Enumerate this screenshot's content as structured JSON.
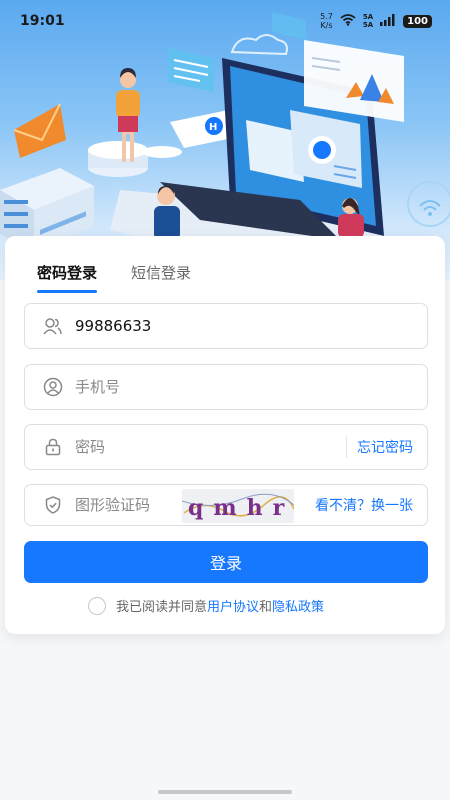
{
  "status_bar": {
    "time": "19:01",
    "net_speed_value": "5.7",
    "net_speed_unit": "K/s",
    "signal_1": "5A",
    "signal_2": "5A",
    "battery": "100"
  },
  "login": {
    "tabs": [
      {
        "label": "密码登录",
        "active": true
      },
      {
        "label": "短信登录",
        "active": false
      }
    ],
    "username_value": "99886633",
    "phone_placeholder": "手机号",
    "password_placeholder": "密码",
    "forgot_password": "忘记密码",
    "captcha_placeholder": "图形验证码",
    "captcha_text": "qmhr",
    "captcha_refresh": "看不清？换一张",
    "submit_label": "登录",
    "agreement_prefix": "我已阅读并同意",
    "user_agreement": "用户协议",
    "agreement_and": "和",
    "privacy_policy": "隐私政策"
  },
  "colors": {
    "accent": "#1677ff",
    "header_top": "#5aa9f0",
    "background": "#f6f7f9"
  },
  "icons": [
    "user-icon",
    "phone-user-icon",
    "lock-icon",
    "shield-icon",
    "wifi-icon",
    "battery-icon"
  ]
}
